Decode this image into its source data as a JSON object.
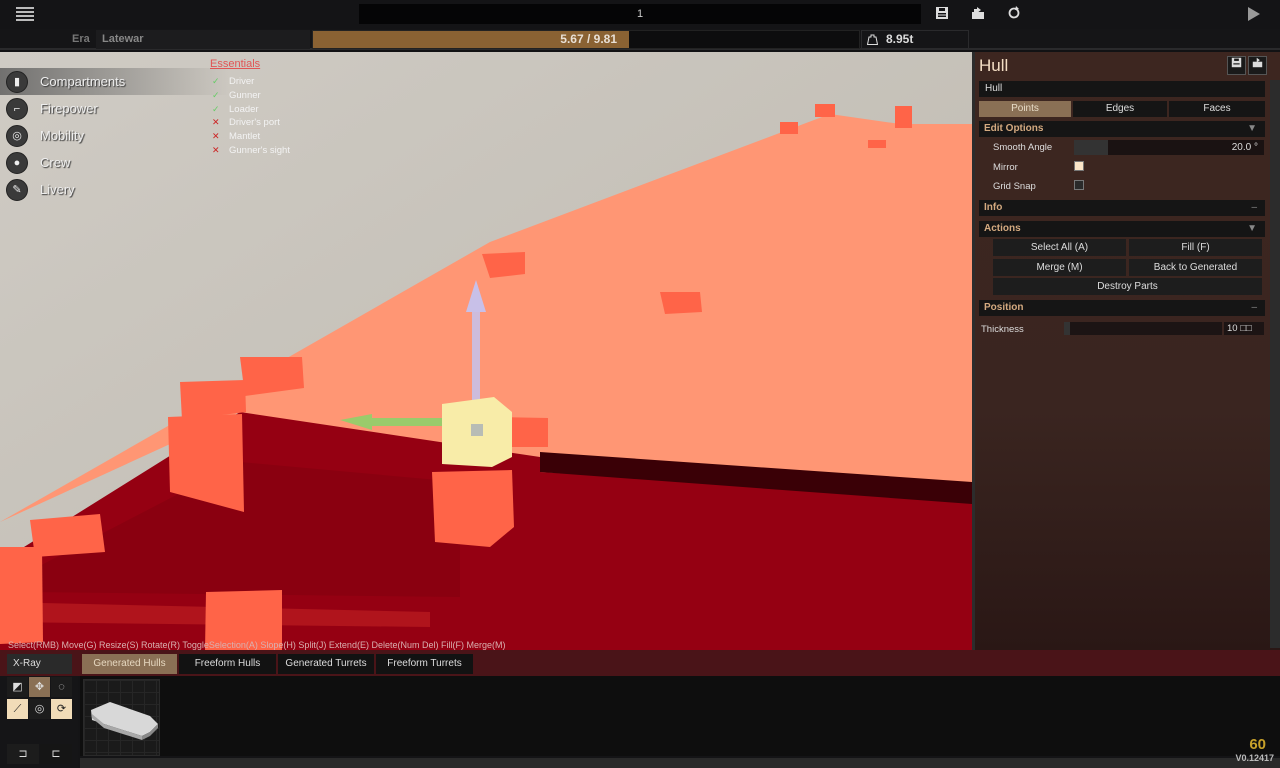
{
  "topbar": {
    "menu_icon": "hamburger-menu-icon",
    "vehicle_name": "1",
    "icons": [
      "save-icon",
      "export-icon",
      "refresh-icon",
      "play-icon"
    ]
  },
  "subbar": {
    "era_label": "Era",
    "era_value": "Latewar",
    "weight_text": "5.67 / 9.81",
    "weight_current": 5.67,
    "weight_max": 9.81,
    "mass_icon": "weight-icon",
    "mass_value": "8.95t"
  },
  "categories": [
    {
      "label": "Compartments",
      "icon": "compartments-icon",
      "active": true
    },
    {
      "label": "Firepower",
      "icon": "firepower-icon",
      "active": false
    },
    {
      "label": "Mobility",
      "icon": "mobility-icon",
      "active": false
    },
    {
      "label": "Crew",
      "icon": "crew-icon",
      "active": false
    },
    {
      "label": "Livery",
      "icon": "livery-icon",
      "active": false
    }
  ],
  "essentials": {
    "title": "Essentials",
    "items": [
      {
        "label": "Driver",
        "ok": true
      },
      {
        "label": "Gunner",
        "ok": true
      },
      {
        "label": "Loader",
        "ok": true
      },
      {
        "label": "Driver's port",
        "ok": false
      },
      {
        "label": "Mantlet",
        "ok": false
      },
      {
        "label": "Gunner's sight",
        "ok": false
      }
    ]
  },
  "hint": "Select(RMB) Move(G) Resize(S) Rotate(R) ToggleSelection(A) Slope(H) Split(J) Extend(E) Delete(Num Del) Fill(F) Merge(M)",
  "panel": {
    "title": "Hull",
    "part_name": "Hull",
    "tabs": [
      {
        "label": "Points",
        "active": true
      },
      {
        "label": "Edges",
        "active": false
      },
      {
        "label": "Faces",
        "active": false
      }
    ],
    "edit_options": {
      "title": "Edit Options",
      "toggle": "▼",
      "smooth_angle_label": "Smooth Angle",
      "smooth_angle_value": "20.0 °",
      "mirror_label": "Mirror",
      "mirror_checked": true,
      "grid_snap_label": "Grid Snap",
      "grid_snap_checked": false
    },
    "info": {
      "title": "Info",
      "toggle": "–"
    },
    "actions": {
      "title": "Actions",
      "toggle": "▼",
      "buttons": [
        "Select All (A)",
        "Fill (F)",
        "Merge (M)",
        "Back to Generated",
        "Destroy Parts"
      ]
    },
    "position": {
      "title": "Position",
      "toggle": "–",
      "thickness_label": "Thickness",
      "thickness_value": "10 □□"
    }
  },
  "bottom": {
    "xray_label": "X-Ray",
    "tabs": [
      {
        "label": "Generated Hulls",
        "active": true
      },
      {
        "label": "Freeform Hulls",
        "active": false
      },
      {
        "label": "Generated Turrets",
        "active": false
      },
      {
        "label": "Freeform Turrets",
        "active": false
      }
    ],
    "tools": [
      "scale-tool-icon",
      "move-tool-icon",
      "rotate-tool-icon",
      "slope-tool-icon",
      "snap-tool-icon",
      "local-rotate-icon"
    ],
    "undo_icon": "undo-icon",
    "redo_icon": "redo-icon",
    "fps": "60",
    "version": "V0.12417"
  },
  "colors": {
    "accent": "#8a6233",
    "panel_bg": "#3d2620",
    "section_title": "#d4aa80",
    "hull_top": "#ff9070",
    "hull_side": "#950010",
    "handle": "#ff6448",
    "fps": "#c8a12a"
  }
}
